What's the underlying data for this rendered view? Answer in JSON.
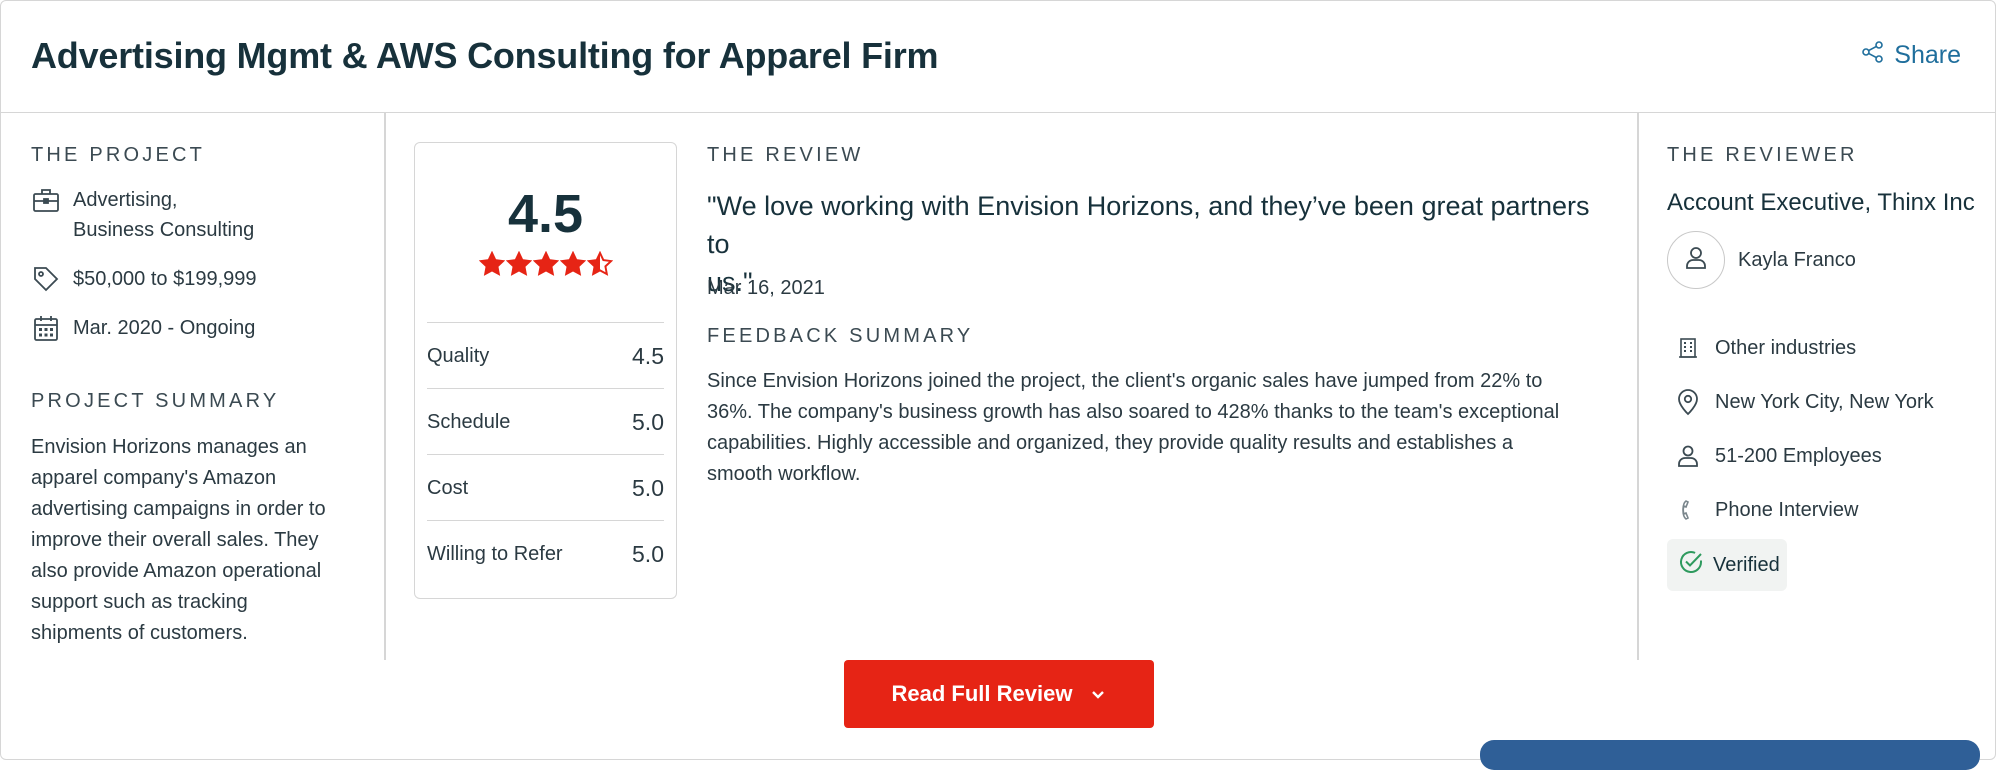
{
  "header": {
    "title": "Advertising Mgmt & AWS Consulting for Apparel Firm",
    "share_label": "Share"
  },
  "project": {
    "section_label": "THE PROJECT",
    "services_line1": "Advertising,",
    "services_line2": "Business Consulting",
    "budget": "$50,000 to $199,999",
    "timeline": "Mar. 2020 - Ongoing",
    "summary_label": "PROJECT SUMMARY",
    "summary_lines": [
      "Envision Horizons manages an",
      "apparel company's Amazon",
      "advertising campaigns in order to",
      "improve their overall sales. They",
      "also provide Amazon operational",
      "support such as tracking",
      "shipments of customers."
    ]
  },
  "ratings": {
    "overall": "4.5",
    "overall_value": 4.5,
    "star_color": "#e62415",
    "rows": [
      {
        "label": "Quality",
        "value": "4.5"
      },
      {
        "label": "Schedule",
        "value": "5.0"
      },
      {
        "label": "Cost",
        "value": "5.0"
      },
      {
        "label": "Willing to Refer",
        "value": "5.0"
      }
    ]
  },
  "review": {
    "section_label": "THE REVIEW",
    "quote_line1": "\"We love working with Envision Horizons, and they’ve been great partners to",
    "quote_line2": "us.\"",
    "date": "Mar 16, 2021",
    "feedback_label": "FEEDBACK SUMMARY",
    "feedback_lines": [
      "Since Envision Horizons joined the project, the client's organic sales have jumped from 22% to",
      "36%. The company's business growth has also soared to 428% thanks to the team's exceptional",
      "capabilities. Highly accessible and organized, they provide quality results and establishes a",
      "smooth workflow."
    ]
  },
  "reviewer": {
    "section_label": "THE REVIEWER",
    "title": "Account Executive, Thinx Inc",
    "name": "Kayla Franco",
    "industry": "Other industries",
    "location": "New York City, New York",
    "size": "51-200 Employees",
    "interview": "Phone Interview",
    "verified": "Verified",
    "verified_color": "#2e9a5e"
  },
  "cta": {
    "read_full_review": "Read Full Review",
    "color": "#e62415"
  },
  "icons": {
    "share": "share-icon",
    "services": "briefcase-icon",
    "budget": "tag-icon",
    "timeline": "calendar-icon",
    "avatar": "user-icon",
    "industry": "building-icon",
    "location": "location-pin-icon",
    "size": "people-icon",
    "interview": "phone-icon",
    "verified": "check-circle-icon",
    "expand": "chevron-down-icon"
  }
}
